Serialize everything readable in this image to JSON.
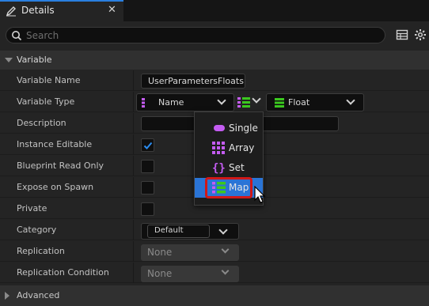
{
  "tab": {
    "title": "Details",
    "close": "✕"
  },
  "search": {
    "placeholder": "Search",
    "value": ""
  },
  "section": {
    "title": "Variable"
  },
  "rows": {
    "variable_name": {
      "label": "Variable Name",
      "value": "UserParametersFloats"
    },
    "variable_type": {
      "label": "Variable Type",
      "key_type": "Name",
      "value_type": "Float"
    },
    "description": {
      "label": "Description",
      "value": ""
    },
    "instance_editable": {
      "label": "Instance Editable",
      "checked": true
    },
    "blueprint_read_only": {
      "label": "Blueprint Read Only",
      "checked": false
    },
    "expose_on_spawn": {
      "label": "Expose on Spawn",
      "checked": false
    },
    "private": {
      "label": "Private",
      "checked": false
    },
    "category": {
      "label": "Category",
      "value": "Default"
    },
    "replication": {
      "label": "Replication",
      "value": "None"
    },
    "replication_condition": {
      "label": "Replication Condition",
      "value": "None"
    }
  },
  "container_menu": {
    "items": [
      {
        "label": "Single",
        "icon": "single-pill-icon"
      },
      {
        "label": "Array",
        "icon": "array-grid-icon"
      },
      {
        "label": "Set",
        "icon": "set-braces-icon"
      },
      {
        "label": "Map",
        "icon": "map-icon",
        "selected": true
      }
    ]
  },
  "advanced": {
    "title": "Advanced"
  },
  "colors": {
    "accent": "#2a74d6",
    "name_type": "#c45cf2",
    "float_type": "#3bc81f",
    "highlight": "#d01818"
  }
}
